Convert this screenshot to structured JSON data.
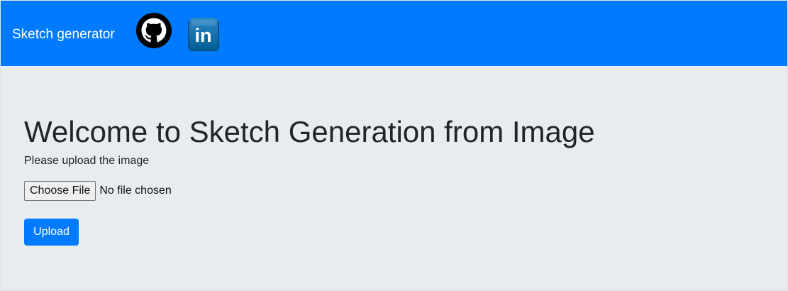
{
  "navbar": {
    "brand": "Sketch generator",
    "links": [
      {
        "icon": "github-icon",
        "title": "GitHub"
      },
      {
        "icon": "linkedin-icon",
        "title": "LinkedIn",
        "logo_text": "in"
      }
    ]
  },
  "main": {
    "title": "Welcome to Sketch Generation from Image",
    "instruction": "Please upload the image",
    "file_input": {
      "button_label": "Choose File",
      "status_text": "No file chosen"
    },
    "upload_label": "Upload"
  },
  "colors": {
    "navbar": "#007bff",
    "background": "#e9ecef",
    "title_text": "#212529",
    "upload_button": "#007bff"
  }
}
